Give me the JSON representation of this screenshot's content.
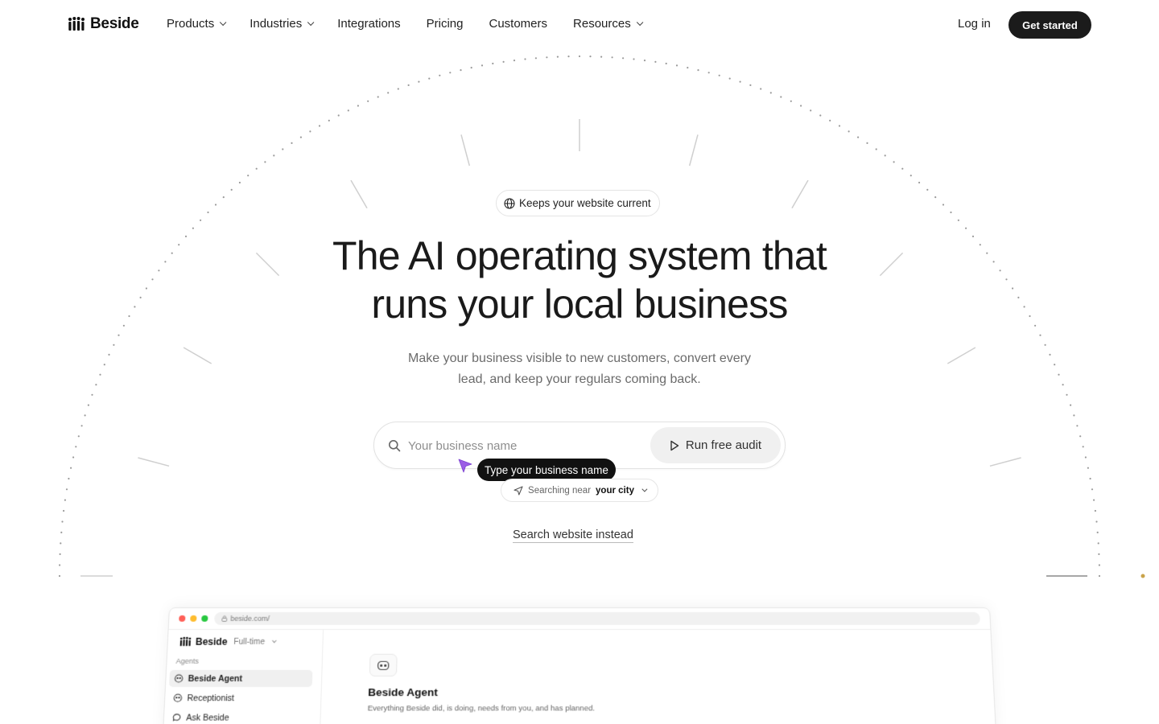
{
  "nav": {
    "logo_text": "Beside",
    "links": [
      {
        "label": "Products",
        "has_dropdown": true
      },
      {
        "label": "Industries",
        "has_dropdown": true
      },
      {
        "label": "Integrations",
        "has_dropdown": false
      },
      {
        "label": "Pricing",
        "has_dropdown": false
      },
      {
        "label": "Customers",
        "has_dropdown": false
      },
      {
        "label": "Resources",
        "has_dropdown": true
      }
    ],
    "login_label": "Log in",
    "cta_label": "Get started"
  },
  "hero": {
    "badge_icon": "globe-icon",
    "badge_text": "Keeps your website current",
    "headline_line1": "The AI operating system that",
    "headline_line2": "runs your local business",
    "subtext_line1": "Make your business visible to new customers, convert every",
    "subtext_line2": "lead, and keep your regulars coming back.",
    "search": {
      "placeholder": "Your business name",
      "value": "",
      "button_label": "Run free audit"
    },
    "tooltip_text": "Type your business name",
    "location": {
      "prefix": "Searching near",
      "city": "your city"
    },
    "alt_link": "Search website instead"
  },
  "preview": {
    "url": "beside.com/",
    "logo_text": "Beside",
    "mode": "Full-time",
    "section_label": "Agents",
    "items": [
      {
        "label": "Beside Agent",
        "icon": "bot-icon",
        "active": true
      },
      {
        "label": "Receptionist",
        "icon": "bot-icon",
        "active": false
      },
      {
        "label": "Ask Beside",
        "icon": "chat-icon",
        "active": false
      }
    ],
    "title": "Beside Agent",
    "description": "Everything Beside did, is doing, needs from you, and has planned."
  },
  "colors": {
    "text": "#1a1a1a",
    "muted": "#6b6b6b",
    "cta_bg": "#1b1b1b",
    "cursor_accent": "#9b5de5",
    "arc_dot": "#c9a34a"
  }
}
